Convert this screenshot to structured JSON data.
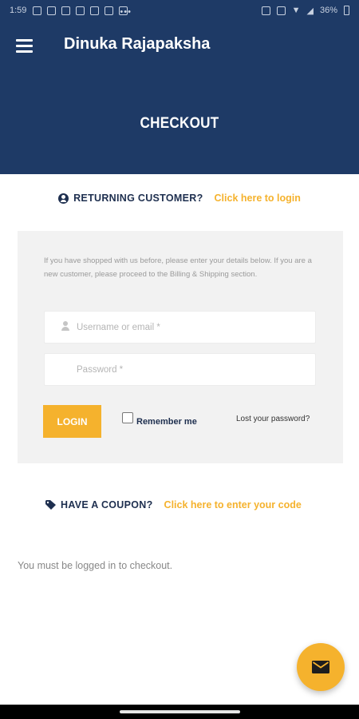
{
  "status_bar": {
    "time": "1:59",
    "battery": "36%"
  },
  "header": {
    "app_title": "Dinuka Rajapaksha",
    "menu_icon": "hamburger-menu-icon",
    "page_heading": "CHECKOUT",
    "background_color": "#1e3a66"
  },
  "returning_customer": {
    "icon": "user-circle-icon",
    "label": "RETURNING CUSTOMER?",
    "link": "Click here to login"
  },
  "login_form": {
    "info_text": "If you have shopped with us before, please enter your details below. If you are a new customer, please proceed to the Billing & Shipping section.",
    "username_placeholder": "Username or email *",
    "password_placeholder": "Password *",
    "login_button": "LOGIN",
    "remember_me": "Remember me",
    "remember_checked": false,
    "lost_password": "Lost your password?"
  },
  "coupon": {
    "icon": "tag-icon",
    "label": "HAVE A COUPON?",
    "link": "Click here to enter your code"
  },
  "notice": "You must be logged in to checkout.",
  "fab": {
    "icon": "mail-icon"
  },
  "colors": {
    "accent": "#f5b22d",
    "navy": "#1e3a66",
    "text_dark": "#1e2f4f"
  }
}
